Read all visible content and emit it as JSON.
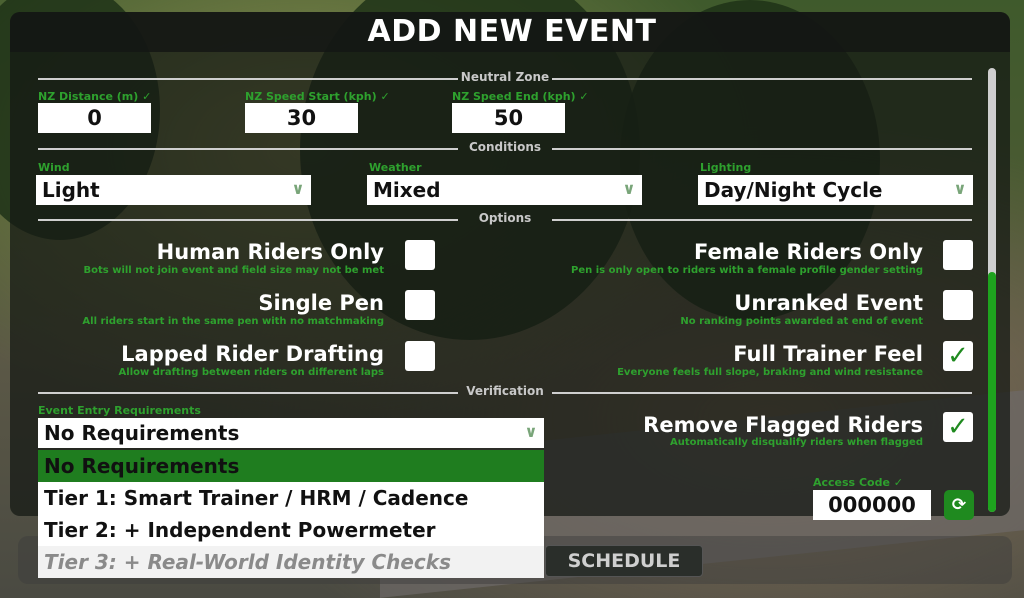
{
  "title": "ADD NEW EVENT",
  "neutral_zone": {
    "heading": "Neutral Zone",
    "distance": {
      "label": "NZ Distance (m)",
      "value": "0"
    },
    "speed_start": {
      "label": "NZ Speed Start (kph)",
      "value": "30"
    },
    "speed_end": {
      "label": "NZ Speed End (kph)",
      "value": "50"
    }
  },
  "conditions": {
    "heading": "Conditions",
    "wind": {
      "label": "Wind",
      "value": "Light"
    },
    "weather": {
      "label": "Weather",
      "value": "Mixed"
    },
    "lighting": {
      "label": "Lighting",
      "value": "Day/Night Cycle"
    }
  },
  "options": {
    "heading": "Options",
    "human_riders_only": {
      "title": "Human Riders Only",
      "desc": "Bots will not join event and field size may not be met",
      "checked": false
    },
    "female_riders_only": {
      "title": "Female Riders Only",
      "desc": "Pen is only open to riders with a female profile gender setting",
      "checked": false
    },
    "single_pen": {
      "title": "Single Pen",
      "desc": "All riders start in the same pen with no matchmaking",
      "checked": false
    },
    "unranked_event": {
      "title": "Unranked Event",
      "desc": "No ranking points awarded at end of event",
      "checked": false
    },
    "lapped_rider_drafting": {
      "title": "Lapped Rider Drafting",
      "desc": "Allow drafting between riders on different laps",
      "checked": false
    },
    "full_trainer_feel": {
      "title": "Full Trainer Feel",
      "desc": "Everyone feels full slope, braking and wind resistance",
      "checked": true
    }
  },
  "verification": {
    "heading": "Verification",
    "entry_label": "Event Entry Requirements",
    "selected": "No Requirements",
    "dropdown_options": [
      "No Requirements",
      "Tier 1: Smart Trainer / HRM / Cadence",
      "Tier 2: + Independent Powermeter",
      "Tier 3: + Real-World Identity Checks"
    ],
    "remove_flagged": {
      "title": "Remove Flagged Riders",
      "desc": "Automatically disqualify riders when flagged",
      "checked": true
    },
    "access_code": {
      "label": "Access Code",
      "value": "000000"
    }
  },
  "buttons": {
    "schedule": "SCHEDULE"
  },
  "icons": {
    "chevron": "chevron-down-icon",
    "check": "check-icon",
    "refresh": "refresh-icon"
  },
  "colors": {
    "accent": "#1f8a1f",
    "label_green": "#2ea12e"
  }
}
